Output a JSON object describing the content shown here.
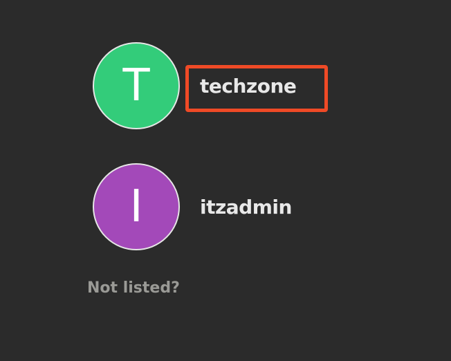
{
  "users": [
    {
      "initial": "T",
      "name": "techzone",
      "avatar_color": "#33cc7a"
    },
    {
      "initial": "I",
      "name": "itzadmin",
      "avatar_color": "#a349b9"
    }
  ],
  "not_listed_label": "Not listed?",
  "highlight_color": "#ef4a26",
  "background_color": "#2b2b2b"
}
